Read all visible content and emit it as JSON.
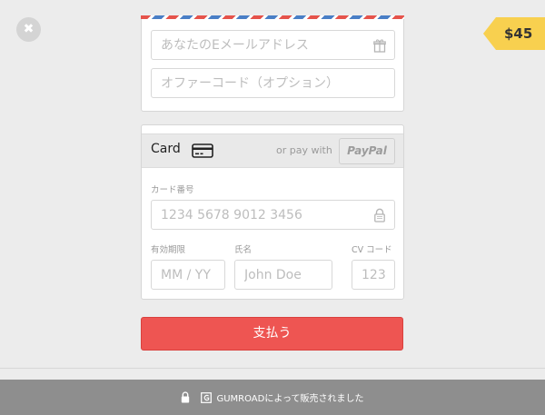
{
  "close": {
    "icon": "close-icon",
    "glyph": "✖"
  },
  "price": {
    "label": "$45",
    "color": "#f8d04f"
  },
  "email": {
    "placeholder": "あなたのEメールアドレス",
    "icon": "gift-icon"
  },
  "offer": {
    "placeholder": "オファーコード（オプション）"
  },
  "payment": {
    "card_label": "Card",
    "card_icon": "credit-card-icon",
    "or_pay_with": "or pay with",
    "paypal_label": "PayPal",
    "card_number": {
      "label": "カード番号",
      "placeholder": "1234 5678 9012 3456",
      "icon": "lock-icon"
    },
    "expiry": {
      "label": "有効期限",
      "placeholder": "MM / YY"
    },
    "name": {
      "label": "氏名",
      "placeholder": "John Doe"
    },
    "cvc": {
      "label": "CV コード",
      "placeholder": "123"
    }
  },
  "submit": {
    "label": "支払う",
    "color": "#ee5552"
  },
  "footer": {
    "text": "GUMROADによって販売されました",
    "icons": [
      "lock-icon",
      "gumroad-logo-icon"
    ]
  }
}
